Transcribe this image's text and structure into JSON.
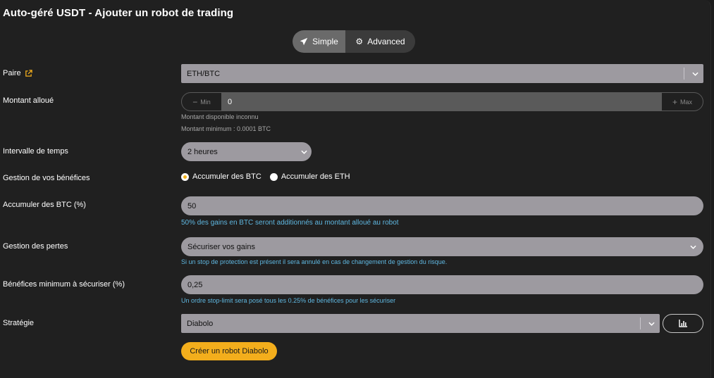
{
  "title": "Auto-géré USDT - Ajouter un robot de trading",
  "mode_toggle": {
    "simple": "Simple",
    "advanced": "Advanced"
  },
  "pair": {
    "label": "Paire",
    "value": "ETH/BTC"
  },
  "amount": {
    "label": "Montant alloué",
    "min_label": "Min",
    "value": "0",
    "max_label": "Max",
    "hint_available": "Montant disponible inconnu",
    "hint_minimum": "Montant minimum : 0.0001 BTC"
  },
  "interval": {
    "label": "Intervalle de temps",
    "value": "2 heures"
  },
  "profits": {
    "label": "Gestion de vos bénéfices",
    "option_1": "Accumuler des BTC",
    "option_2": "Accumuler des ETH",
    "selected": "option_1"
  },
  "accumulate": {
    "label": "Accumuler des BTC (%)",
    "value": "50",
    "note": "50% des gains en BTC seront additionnés au montant alloué au robot"
  },
  "losses": {
    "label": "Gestion des pertes",
    "value": "Sécuriser vos gains",
    "note": "Si un stop de protection est présent il sera annulé en cas de changement de gestion du risque."
  },
  "min_profit": {
    "label": "Bénéfices minimum à sécuriser (%)",
    "value": "0,25",
    "note": "Un ordre stop-limit sera posé tous les 0.25% de bénéfices pour les sécuriser"
  },
  "strategy": {
    "label": "Stratégie",
    "value": "Diabolo"
  },
  "create_button": "Créer un robot Diabolo",
  "colors": {
    "accent": "#f3ae1c",
    "info": "#5fb7e0",
    "background": "#202020"
  }
}
